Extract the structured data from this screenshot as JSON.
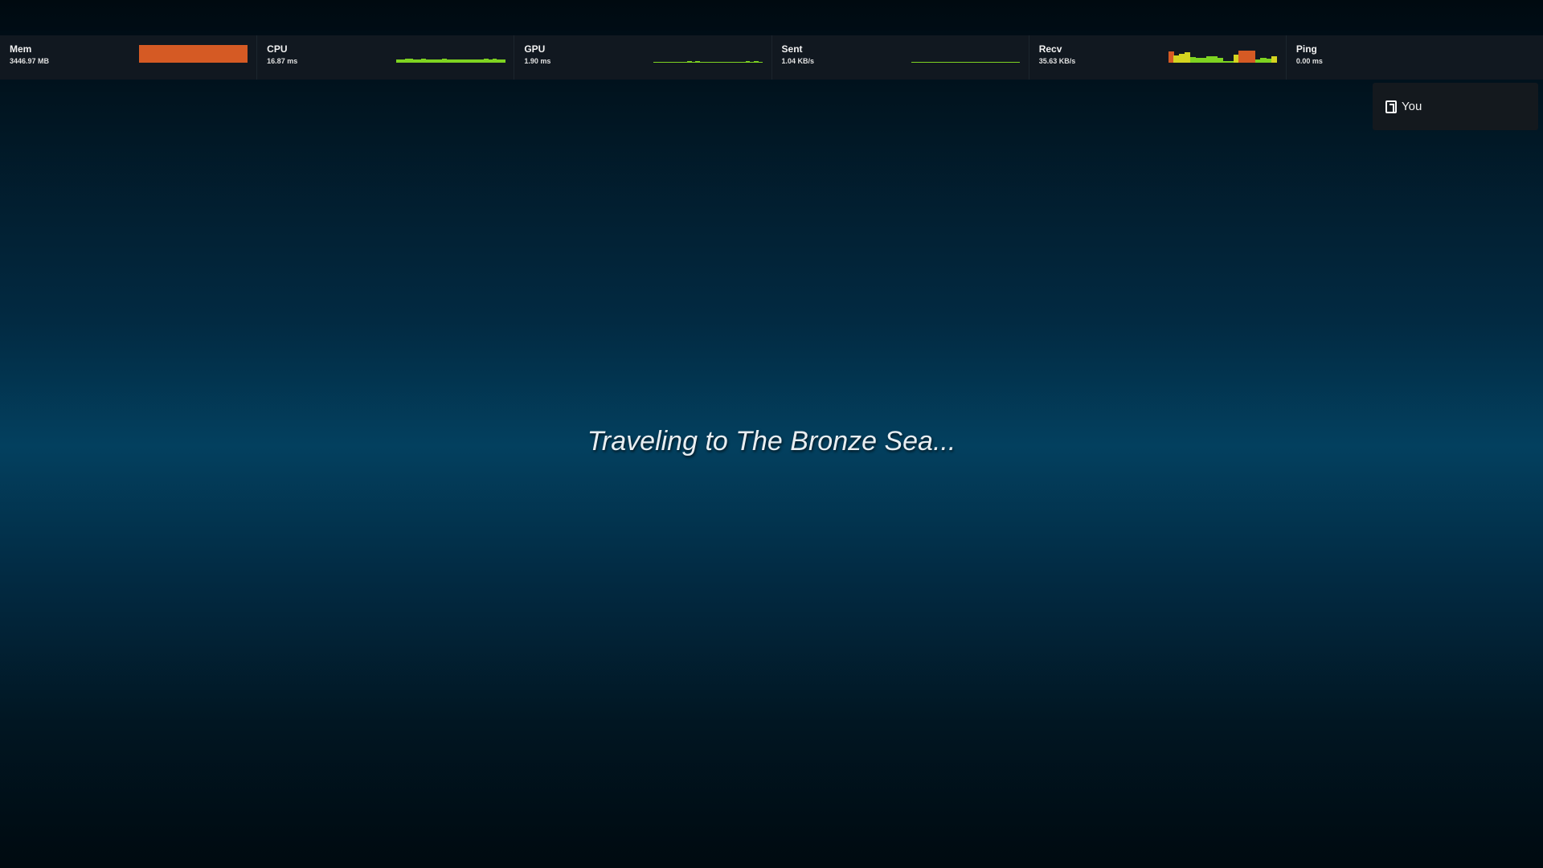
{
  "stats": [
    {
      "label": "Mem",
      "value": "3446.97 MB",
      "type": "fill",
      "fill": 1.0,
      "color": "#d55a24"
    },
    {
      "label": "CPU",
      "value": "16.87 ms",
      "type": "bars",
      "bars": [
        4,
        4,
        5,
        5,
        4,
        4,
        5,
        4,
        4,
        4,
        4,
        5,
        4,
        4,
        4,
        4,
        4,
        4,
        4,
        4,
        4,
        5,
        4,
        5,
        4,
        4
      ],
      "color": "#7ed321"
    },
    {
      "label": "GPU",
      "value": "1.90 ms",
      "type": "bars",
      "bars": [
        1,
        1,
        1,
        1,
        1,
        1,
        1,
        1,
        2,
        1,
        2,
        1,
        1,
        1,
        1,
        1,
        1,
        1,
        1,
        1,
        1,
        1,
        2,
        1,
        2,
        1
      ],
      "color": "#7ed321"
    },
    {
      "label": "Sent",
      "value": "1.04 KB/s",
      "type": "bars",
      "bars": [
        1,
        1,
        1,
        1,
        1,
        1,
        1,
        1,
        1,
        1,
        1,
        1,
        1,
        1,
        1,
        1,
        1,
        1,
        1,
        1,
        1,
        1,
        1,
        1,
        1,
        1
      ],
      "color": "#7ed321"
    },
    {
      "label": "Recv",
      "value": "35.63 KB/s",
      "type": "bars",
      "bars": [
        14,
        9,
        11,
        13,
        7,
        6,
        6,
        8,
        8,
        6,
        2,
        2,
        10,
        15,
        15,
        15,
        4,
        6,
        5,
        8
      ],
      "colors": [
        "#d55a24",
        "#d4d420",
        "#d4d420",
        "#d4d420",
        "#7ed321",
        "#7ed321",
        "#7ed321",
        "#7ed321",
        "#7ed321",
        "#7ed321",
        "#7ed321",
        "#7ed321",
        "#d4d420",
        "#d55a24",
        "#d55a24",
        "#d55a24",
        "#7ed321",
        "#7ed321",
        "#7ed321",
        "#d4d420"
      ]
    },
    {
      "label": "Ping",
      "value": "0.00 ms",
      "type": "none"
    }
  ],
  "player": {
    "label": "You"
  },
  "message": "Traveling to The Bronze Sea..."
}
